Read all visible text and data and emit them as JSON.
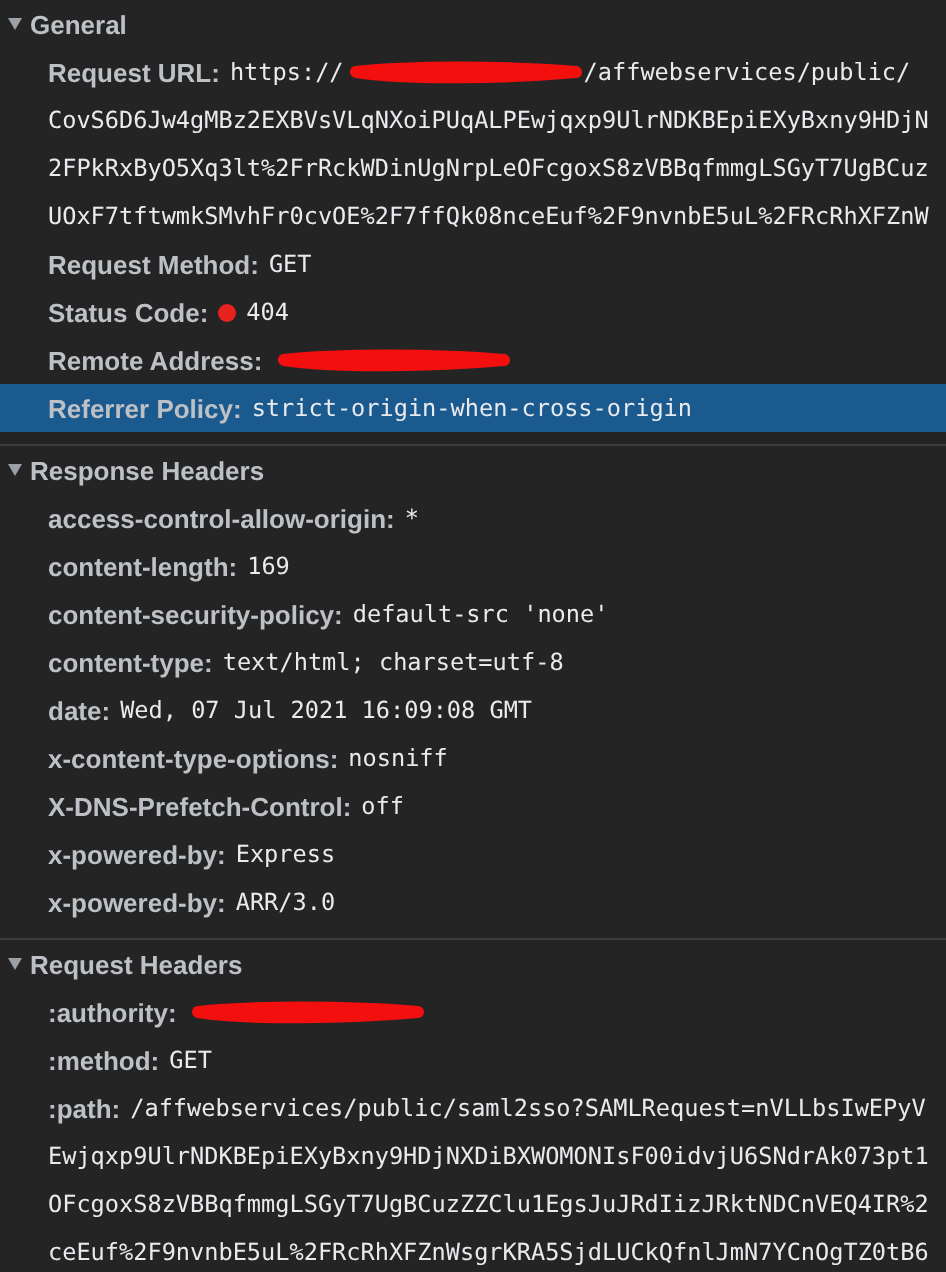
{
  "sections": [
    {
      "title": "General",
      "expanded": true,
      "rows": [
        {
          "name": "Request URL:",
          "selected": false,
          "value": [
            {
              "kind": "text",
              "text": "https://"
            },
            {
              "kind": "redaction"
            },
            {
              "kind": "text",
              "text": "/affwebservices/public/"
            }
          ],
          "continuation": [
            "CovS6D6Jw4gMBz2EXBVsVLqNXoiPUqALPEwjqxp9UlrNDKBEpiEXyBxny9HDjN",
            "2FPkRxByO5Xq3lt%2FrRckWDinUgNrpLeOFcgoxS8zVBBqfmmgLSGyT7UgBCuz",
            "UOxF7tftwmkSMvhFr0cvOE%2F7ffQk08nceEuf%2F9nvnbE5uL%2FRcRhXFZnW"
          ]
        },
        {
          "name": "Request Method:",
          "selected": false,
          "value": [
            {
              "kind": "text",
              "text": "GET"
            }
          ]
        },
        {
          "name": "Status Code:",
          "selected": false,
          "value": [
            {
              "kind": "status-dot",
              "color": "#e8231d"
            },
            {
              "kind": "text",
              "text": "404"
            }
          ]
        },
        {
          "name": "Remote Address:",
          "selected": false,
          "value": [
            {
              "kind": "redaction"
            }
          ]
        },
        {
          "name": "Referrer Policy:",
          "selected": true,
          "value": [
            {
              "kind": "text",
              "text": "strict-origin-when-cross-origin"
            }
          ]
        }
      ]
    },
    {
      "title": "Response Headers",
      "expanded": true,
      "rows": [
        {
          "name": "access-control-allow-origin:",
          "selected": false,
          "value": [
            {
              "kind": "text",
              "text": "*"
            }
          ]
        },
        {
          "name": "content-length:",
          "selected": false,
          "value": [
            {
              "kind": "text",
              "text": "169"
            }
          ]
        },
        {
          "name": "content-security-policy:",
          "selected": false,
          "value": [
            {
              "kind": "text",
              "text": "default-src 'none'"
            }
          ]
        },
        {
          "name": "content-type:",
          "selected": false,
          "value": [
            {
              "kind": "text",
              "text": "text/html; charset=utf-8"
            }
          ]
        },
        {
          "name": "date:",
          "selected": false,
          "value": [
            {
              "kind": "text",
              "text": "Wed, 07 Jul 2021 16:09:08 GMT"
            }
          ]
        },
        {
          "name": "x-content-type-options:",
          "selected": false,
          "value": [
            {
              "kind": "text",
              "text": "nosniff"
            }
          ]
        },
        {
          "name": "X-DNS-Prefetch-Control:",
          "selected": false,
          "value": [
            {
              "kind": "text",
              "text": "off"
            }
          ]
        },
        {
          "name": "x-powered-by:",
          "selected": false,
          "value": [
            {
              "kind": "text",
              "text": "Express"
            }
          ]
        },
        {
          "name": "x-powered-by:",
          "selected": false,
          "value": [
            {
              "kind": "text",
              "text": "ARR/3.0"
            }
          ]
        }
      ]
    },
    {
      "title": "Request Headers",
      "expanded": true,
      "rows": [
        {
          "name": ":authority:",
          "selected": false,
          "value": [
            {
              "kind": "redaction"
            }
          ]
        },
        {
          "name": ":method:",
          "selected": false,
          "value": [
            {
              "kind": "text",
              "text": "GET"
            }
          ]
        },
        {
          "name": ":path:",
          "selected": false,
          "value": [
            {
              "kind": "text",
              "text": "/affwebservices/public/saml2sso?SAMLRequest=nVLLbsIwEPyV"
            }
          ],
          "continuation": [
            "Ewjqxp9UlrNDKBEpiEXyBxny9HDjNXDiBXWOMONIsF00idvjU6SNdrAk073pt1",
            "OFcgoxS8zVBBqfmmgLSGyT7UgBCuzZZClu1EgsJuJRdIizJRktNDCnVEQ4IR%2",
            "ceEuf%2F9nvnbE5uL%2FRcRhXFZnWsgrKRA5SjdLUCkQfnlJmN7YCnOgTZ0tB6"
          ]
        }
      ]
    }
  ]
}
